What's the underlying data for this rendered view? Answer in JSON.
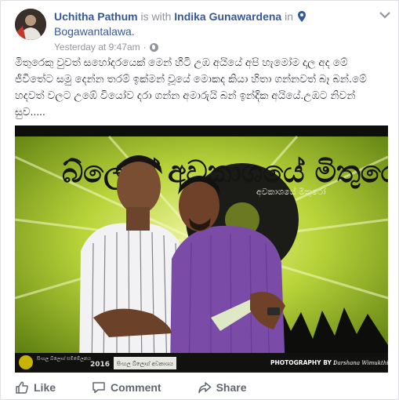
{
  "post": {
    "author": "Uchitha Pathum",
    "with_text": "is with",
    "tagged": "Indika Gunawardena",
    "in_text": "in",
    "location": "Bogawantalawa.",
    "timestamp": "Yesterday at 9:47am",
    "separator": "·",
    "text": "මිතුරෙකු වුවත් සහෝදරයෙක් මෙන් හිටි උඹ අයියේ අපි හැමෝම දාල අද මේ ජීවිතේට සමු දෙන්න තරම් ඉක්මන් වූයේ මොකද කියා හිතා ගන්නවත් බෑ බන්.මේ හදවත් වලට උඹේ වියෝව දරා ගන්න අමාරුයි බන් ඉන්දික අයියේ.උඹට නිවන් සුව....."
  },
  "photo": {
    "banner_text": "බ්ලොග් අවකාශයේ මිතුරෝ",
    "badge_text": "අවකාශයේ මිතුරෝ",
    "credit": "PHOTOGRAPHY BY :",
    "credit_name": "Darshana Wimukthi",
    "footer_year": "2016",
    "footer_text_left": "සිංහල බ්ලොග් සම්මේලනය",
    "footer_text_mid": "සිංහල බ්ලොග් අවකාශය"
  },
  "actions": {
    "like": "Like",
    "comment": "Comment",
    "share": "Share"
  },
  "colors": {
    "link": "#365899",
    "meta": "#90949c",
    "text": "#1d2129",
    "action": "#616770"
  }
}
